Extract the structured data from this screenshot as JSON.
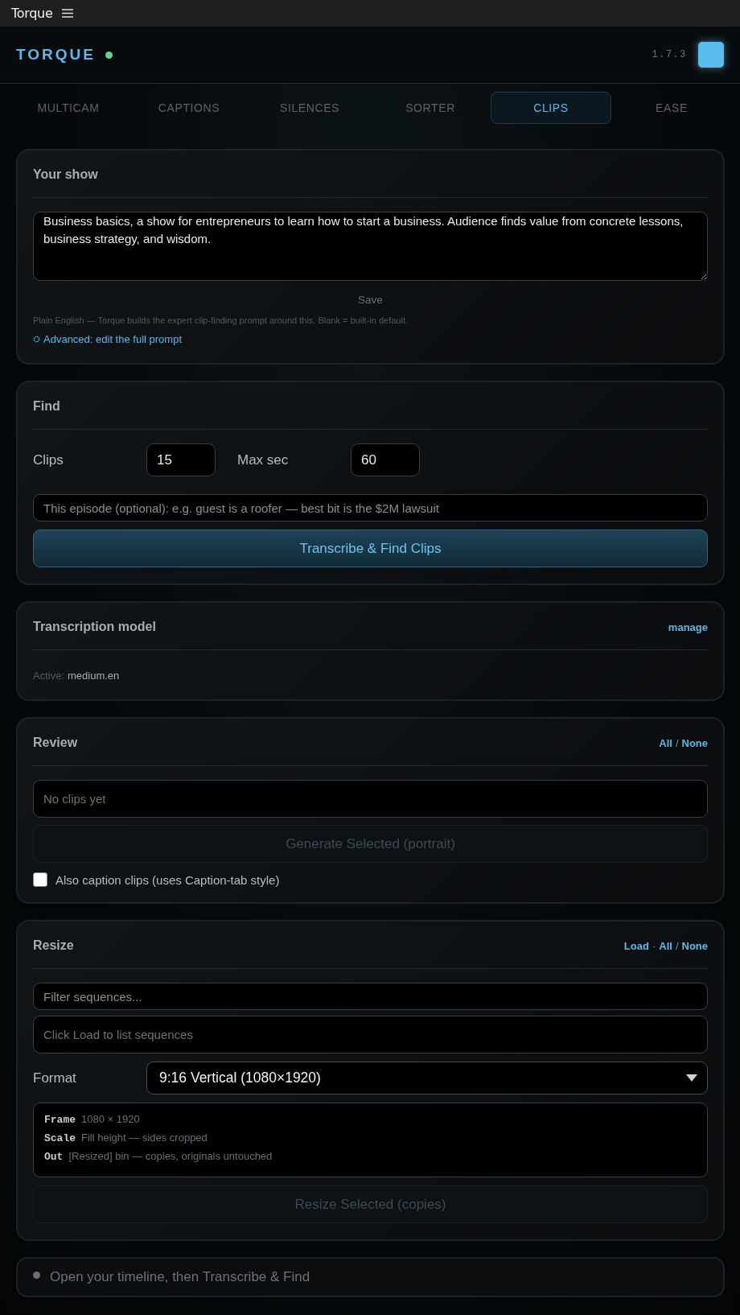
{
  "app_bar": {
    "title": "Torque"
  },
  "header": {
    "brand": "TORQUE",
    "version": "1.7.3"
  },
  "tabs": [
    {
      "label": "MULTICAM",
      "selected": false
    },
    {
      "label": "CAPTIONS",
      "selected": false
    },
    {
      "label": "SILENCES",
      "selected": false
    },
    {
      "label": "SORTER",
      "selected": false
    },
    {
      "label": "CLIPS",
      "selected": true
    },
    {
      "label": "EASE",
      "selected": false
    }
  ],
  "show": {
    "title": "Your show",
    "description": "Business basics, a show for entrepreneurs to learn how to start a business. Audience finds value from concrete lessons, business strategy, and wisdom.",
    "save": "Save",
    "hint": "Plain English — Torque builds the expert clip-finding prompt around this. Blank = built-in default.",
    "advanced_link": "Advanced: edit the full prompt"
  },
  "find": {
    "title": "Find",
    "clips_label": "Clips",
    "clips_value": "15",
    "max_label": "Max sec",
    "max_value": "60",
    "episode_placeholder": "This episode (optional): e.g. guest is a roofer — best bit is the $2M lawsuit",
    "button": {
      "label": "Transcribe & Find Clips",
      "disabled": false
    }
  },
  "model": {
    "title": "Transcription model",
    "action": "manage",
    "active_label": "Active:",
    "active_value": "medium.en"
  },
  "review": {
    "title": "Review",
    "actions": [
      {
        "kind": "link",
        "text": "All"
      },
      {
        "kind": "sep",
        "text": "/"
      },
      {
        "kind": "link",
        "text": "None"
      }
    ],
    "empty_message": "No clips yet",
    "button": {
      "label": "Generate Selected (portrait)",
      "disabled": true
    },
    "checkbox": {
      "label": "Also caption clips (uses Caption-tab style)",
      "checked": false
    }
  },
  "resize": {
    "title": "Resize",
    "actions": [
      {
        "kind": "link",
        "text": "Load"
      },
      {
        "kind": "sep",
        "text": "·"
      },
      {
        "kind": "link",
        "text": "All"
      },
      {
        "kind": "sep",
        "text": "/"
      },
      {
        "kind": "link",
        "text": "None"
      }
    ],
    "filter_placeholder": "Filter sequences...",
    "empty_message": "Click Load to list sequences",
    "format_label": "Format",
    "format_value": "9:16 Vertical (1080×1920)",
    "info": [
      {
        "key": "Frame",
        "value": "1080 × 1920"
      },
      {
        "key": "Scale",
        "value": "Fill height — sides cropped"
      },
      {
        "key": "Out",
        "value": "[Resized] bin — copies, originals untouched"
      }
    ],
    "button": {
      "label": "Resize Selected (copies)",
      "disabled": true
    }
  },
  "status": {
    "message": "Open your timeline, then Transcribe & Find"
  }
}
